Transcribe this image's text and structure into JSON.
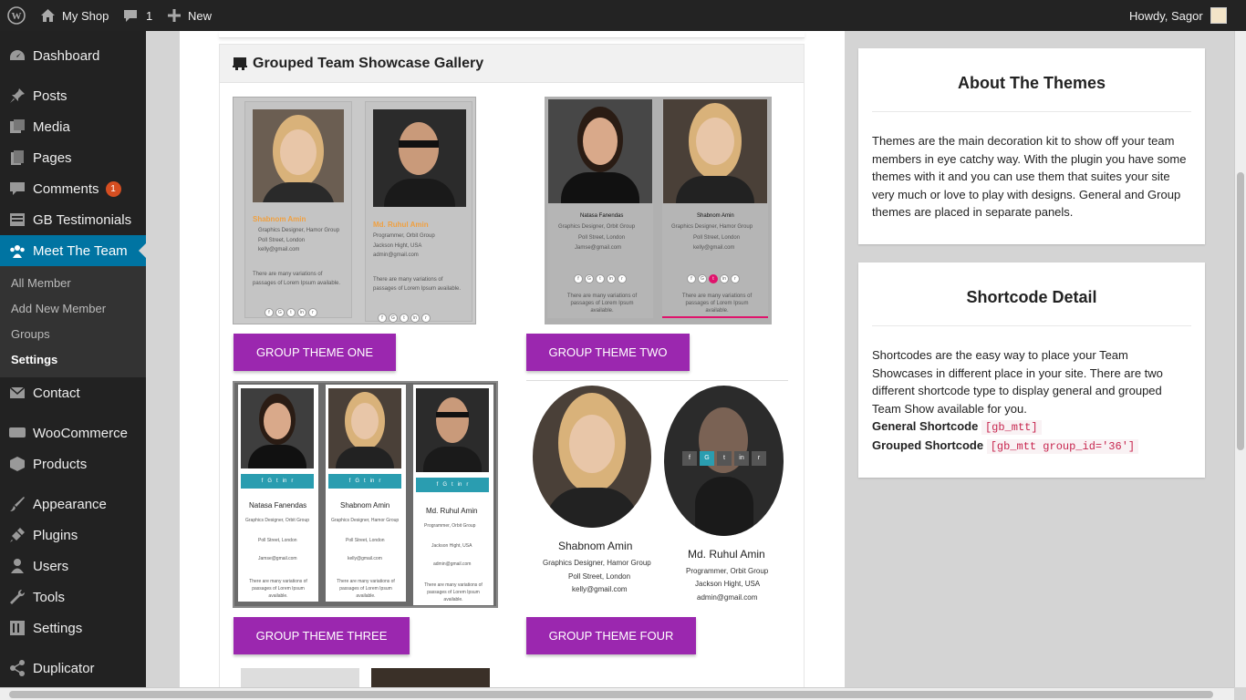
{
  "adminbar": {
    "site_name": "My Shop",
    "comments_count": "1",
    "new_label": "New",
    "howdy": "Howdy, Sagor"
  },
  "sidebar": {
    "items": [
      {
        "label": "Dashboard",
        "icon": "dashboard-icon"
      },
      {
        "label": "Posts",
        "icon": "pin-icon"
      },
      {
        "label": "Media",
        "icon": "media-icon"
      },
      {
        "label": "Pages",
        "icon": "pages-icon"
      },
      {
        "label": "Comments",
        "icon": "comment-icon",
        "badge": "1"
      },
      {
        "label": "GB Testimonials",
        "icon": "testimonial-icon"
      },
      {
        "label": "Meet The Team",
        "icon": "team-icon",
        "active": true
      },
      {
        "label": "Contact",
        "icon": "mail-icon"
      },
      {
        "label": "WooCommerce",
        "icon": "woocommerce-icon"
      },
      {
        "label": "Products",
        "icon": "products-icon"
      },
      {
        "label": "Appearance",
        "icon": "brush-icon"
      },
      {
        "label": "Plugins",
        "icon": "plugin-icon"
      },
      {
        "label": "Users",
        "icon": "user-icon"
      },
      {
        "label": "Tools",
        "icon": "wrench-icon"
      },
      {
        "label": "Settings",
        "icon": "settings-icon"
      },
      {
        "label": "Duplicator",
        "icon": "share-icon"
      }
    ],
    "submenu": [
      "All Member",
      "Add New Member",
      "Groups",
      "Settings"
    ]
  },
  "panel": {
    "title": "Grouped Team Showcase Gallery",
    "buttons": [
      "GROUP THEME ONE",
      "GROUP THEME TWO",
      "GROUP THEME THREE",
      "GROUP THEME FOUR"
    ]
  },
  "members": {
    "shabnom": {
      "name": "Shabnom Amin",
      "role": "Graphics Designer, Hamor Group",
      "addr": "Poll Street, London",
      "email": "kelly@gmail.com"
    },
    "ruhul": {
      "name": "Md. Ruhul Amin",
      "role": "Programmer, Orbit Group",
      "addr": "Jackson Hight, USA",
      "email": "admin@gmail.com"
    },
    "natasa": {
      "name": "Natasa Fanendas",
      "role": "Graphics Designer, Orbit Group",
      "addr": "Poll Street, London",
      "email": "Jamse@gmail.com"
    },
    "bio": "There are many variations of passages of Lorem Ipsum available."
  },
  "about": {
    "title": "About The Themes",
    "body": "Themes are the main decoration kit to show off your team members in eye catchy way. With the plugin you have some themes with it and you can use them that suites your site very much or love to play with designs. General and Group themes are placed in separate panels."
  },
  "shortcode": {
    "title": "Shortcode Detail",
    "body": "Shortcodes are the easy way to place your Team Showcases in different place in your site. There are two different shortcode type to display general and grouped Team Show available for you.",
    "general_label": "General Shortcode",
    "general_code": "[gb_mtt]",
    "grouped_label": "Grouped Shortcode",
    "grouped_code": "[gb_mtt group_id='36']"
  },
  "social_icons": [
    "f",
    "G+",
    "t",
    "in",
    "rss"
  ]
}
